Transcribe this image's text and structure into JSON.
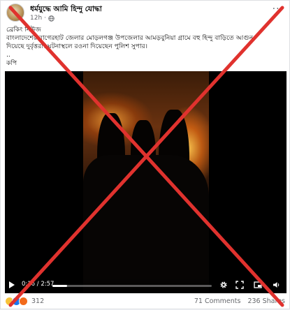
{
  "header": {
    "page_name": "ধর্মযুদ্ধে আমি হিন্দু যোদ্ধা",
    "timestamp": "12h",
    "more_label": "···"
  },
  "post": {
    "lines": [
      "ব্রেকিং নিউজ",
      "বাংলাদেশের বাগেরহাট জেলার মোড়লগঞ্জ উপজেলার আমড়বুনিয়া গ্রামে বহু হিন্দু বাড়িতে আগুন",
      "দিয়েছে দুর্বৃত্তরা। ঘটনাস্থলে রওনা দিয়েছেন পুলিশ সুপার।",
      "..",
      "কপি"
    ]
  },
  "video": {
    "time": "0:16 / 2:57",
    "progress": 0.09
  },
  "footer": {
    "reaction_count": "312",
    "comments": "71 Comments",
    "shares": "236 Shares"
  },
  "colors": {
    "cross": "#e0322e",
    "like": "#1877f2",
    "angry": "#f26a1b",
    "sad": "#f7c33b"
  },
  "icons": {
    "globe": "globe-icon",
    "play": "play-icon",
    "settings": "gear-icon",
    "fullscreen": "fullscreen-icon",
    "pip": "picture-in-picture-icon",
    "volume": "volume-icon"
  }
}
